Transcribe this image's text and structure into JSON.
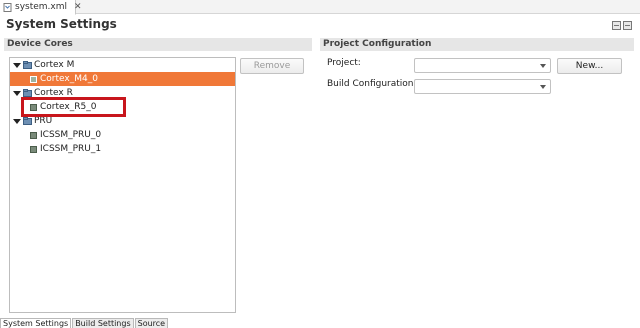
{
  "editor_tab": {
    "label": "system.xml",
    "close": "✕"
  },
  "page": {
    "title": "System Settings"
  },
  "device_cores": {
    "header": "Device Cores",
    "tree": [
      {
        "label": "Cortex M",
        "kind": "group"
      },
      {
        "label": "Cortex_M4_0",
        "kind": "core",
        "selected": true
      },
      {
        "label": "Cortex R",
        "kind": "group"
      },
      {
        "label": "Cortex_R5_0",
        "kind": "core"
      },
      {
        "label": "PRU",
        "kind": "group"
      },
      {
        "label": "ICSSM_PRU_0",
        "kind": "core"
      },
      {
        "label": "ICSSM_PRU_1",
        "kind": "core"
      }
    ],
    "remove_label": "Remove"
  },
  "project_configuration": {
    "header": "Project Configuration",
    "project_label": "Project:",
    "project_value": "",
    "new_label": "New...",
    "build_config_label": "Build Configuration:",
    "build_config_value": ""
  },
  "bottom_tabs": [
    "System Settings",
    "Build Settings",
    "Source"
  ],
  "colors": {
    "selection": "#f07838",
    "highlight_box": "#c8161c"
  }
}
